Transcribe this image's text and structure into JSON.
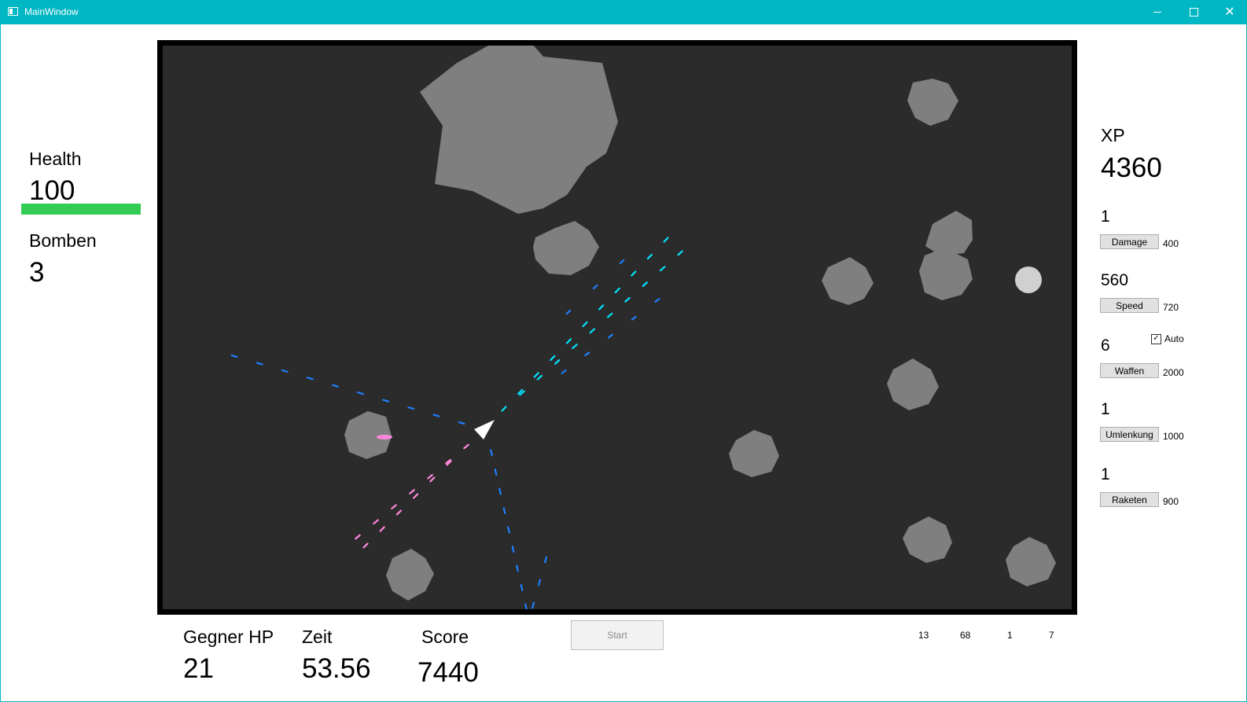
{
  "window": {
    "title": "MainWindow"
  },
  "left_panel": {
    "health_label": "Health",
    "health_value": "100",
    "health_fraction": 1.0,
    "bomb_label": "Bomben",
    "bomb_value": "3"
  },
  "right_panel": {
    "xp_label": "XP",
    "xp_value": "4360",
    "upgrades": [
      {
        "value": "1",
        "button": "Damage",
        "cost": "400"
      },
      {
        "value": "560",
        "button": "Speed",
        "cost": "720"
      },
      {
        "value": "6",
        "button": "Waffen",
        "cost": "2000"
      },
      {
        "value": "1",
        "button": "Umlenkung",
        "cost": "1000"
      },
      {
        "value": "1",
        "button": "Raketen",
        "cost": "900"
      }
    ],
    "auto_label": "Auto",
    "auto_checked": true
  },
  "bottom": {
    "enemy_hp_label": "Gegner HP",
    "enemy_hp_value": "21",
    "time_label": "Zeit",
    "time_value": "53.56",
    "score_label": "Score",
    "score_value": "7440",
    "start_label": "Start",
    "counters": [
      "13",
      "68",
      "1",
      "7"
    ]
  },
  "colors": {
    "titlebar": "#00b7c3",
    "game_bg": "#2b2b2b",
    "asteroid": "#7f7f7f",
    "health_green": "#33cc55",
    "bullet_cyan": "#00e5ff",
    "bullet_blue": "#1e7fff",
    "bullet_pink": "#ff88dd",
    "bullet_purple": "#8a6fd0",
    "ship": "#ffffff",
    "orb": "#d0d0d0"
  }
}
